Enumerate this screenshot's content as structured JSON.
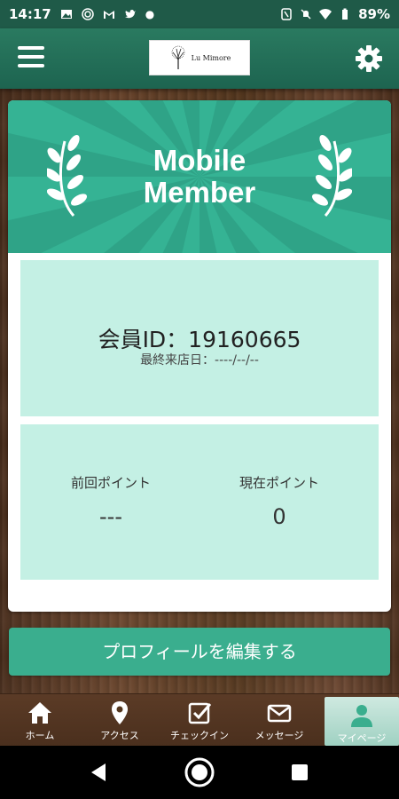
{
  "status_bar": {
    "time": "14:17",
    "battery": "89%",
    "left_icons": [
      "image-icon",
      "target-icon",
      "gmail-icon",
      "twitter-icon",
      "dot-icon"
    ],
    "right_icons": [
      "nfc-icon",
      "mute-icon",
      "wifi-icon",
      "battery-icon"
    ]
  },
  "app_bar": {
    "logo_text": "Lu Mimore"
  },
  "member_card": {
    "banner_title_line1": "Mobile",
    "banner_title_line2": "Member",
    "member_id": "会員ID：19160665",
    "last_visit": "最終来店日：----/--/--",
    "previous_points_label": "前回ポイント",
    "previous_points_value": "---",
    "current_points_label": "現在ポイント",
    "current_points_value": "0"
  },
  "edit_button": {
    "label": "プロフィールを編集する"
  },
  "tabs": [
    {
      "label": "ホーム",
      "icon": "home-icon"
    },
    {
      "label": "アクセス",
      "icon": "map-pin-icon"
    },
    {
      "label": "チェックイン",
      "icon": "checkbox-icon"
    },
    {
      "label": "メッセージ",
      "icon": "envelope-icon"
    },
    {
      "label": "マイページ",
      "icon": "person-icon",
      "active": true
    }
  ],
  "colors": {
    "accent": "#35b394",
    "panel": "#c4f0e4",
    "appbar": "#1d6450",
    "button": "#3aae8e"
  }
}
